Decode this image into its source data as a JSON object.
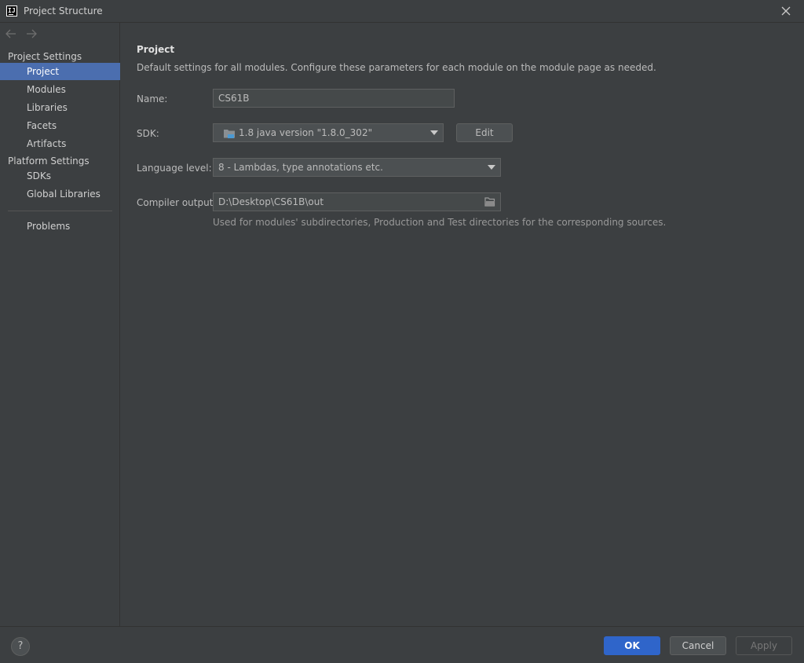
{
  "window": {
    "title": "Project Structure",
    "logo_text": "IJ"
  },
  "sidebar": {
    "project_settings_header": "Project Settings",
    "project_items": [
      {
        "label": "Project",
        "selected": true
      },
      {
        "label": "Modules"
      },
      {
        "label": "Libraries"
      },
      {
        "label": "Facets"
      },
      {
        "label": "Artifacts"
      }
    ],
    "platform_settings_header": "Platform Settings",
    "platform_items": [
      {
        "label": "SDKs"
      },
      {
        "label": "Global Libraries"
      }
    ],
    "problems_label": "Problems"
  },
  "main": {
    "title": "Project",
    "description": "Default settings for all modules. Configure these parameters for each module on the module page as needed.",
    "name_label": "Name:",
    "name_value": "CS61B",
    "sdk_label": "SDK:",
    "sdk_value": "1.8 java version \"1.8.0_302\"",
    "edit_label": "Edit",
    "language_level_label": "Language level:",
    "language_level_value": "8 - Lambdas, type annotations etc.",
    "compiler_output_label": "Compiler output:",
    "compiler_output_value": "D:\\Desktop\\CS61B\\out",
    "compiler_output_hint": "Used for modules' subdirectories, Production and Test directories for the corresponding sources."
  },
  "footer": {
    "help_label": "?",
    "ok_label": "OK",
    "cancel_label": "Cancel",
    "apply_label": "Apply"
  },
  "colors": {
    "selection": "#4b6eaf",
    "primary_button": "#2f65ca",
    "background": "#3c3f41"
  }
}
